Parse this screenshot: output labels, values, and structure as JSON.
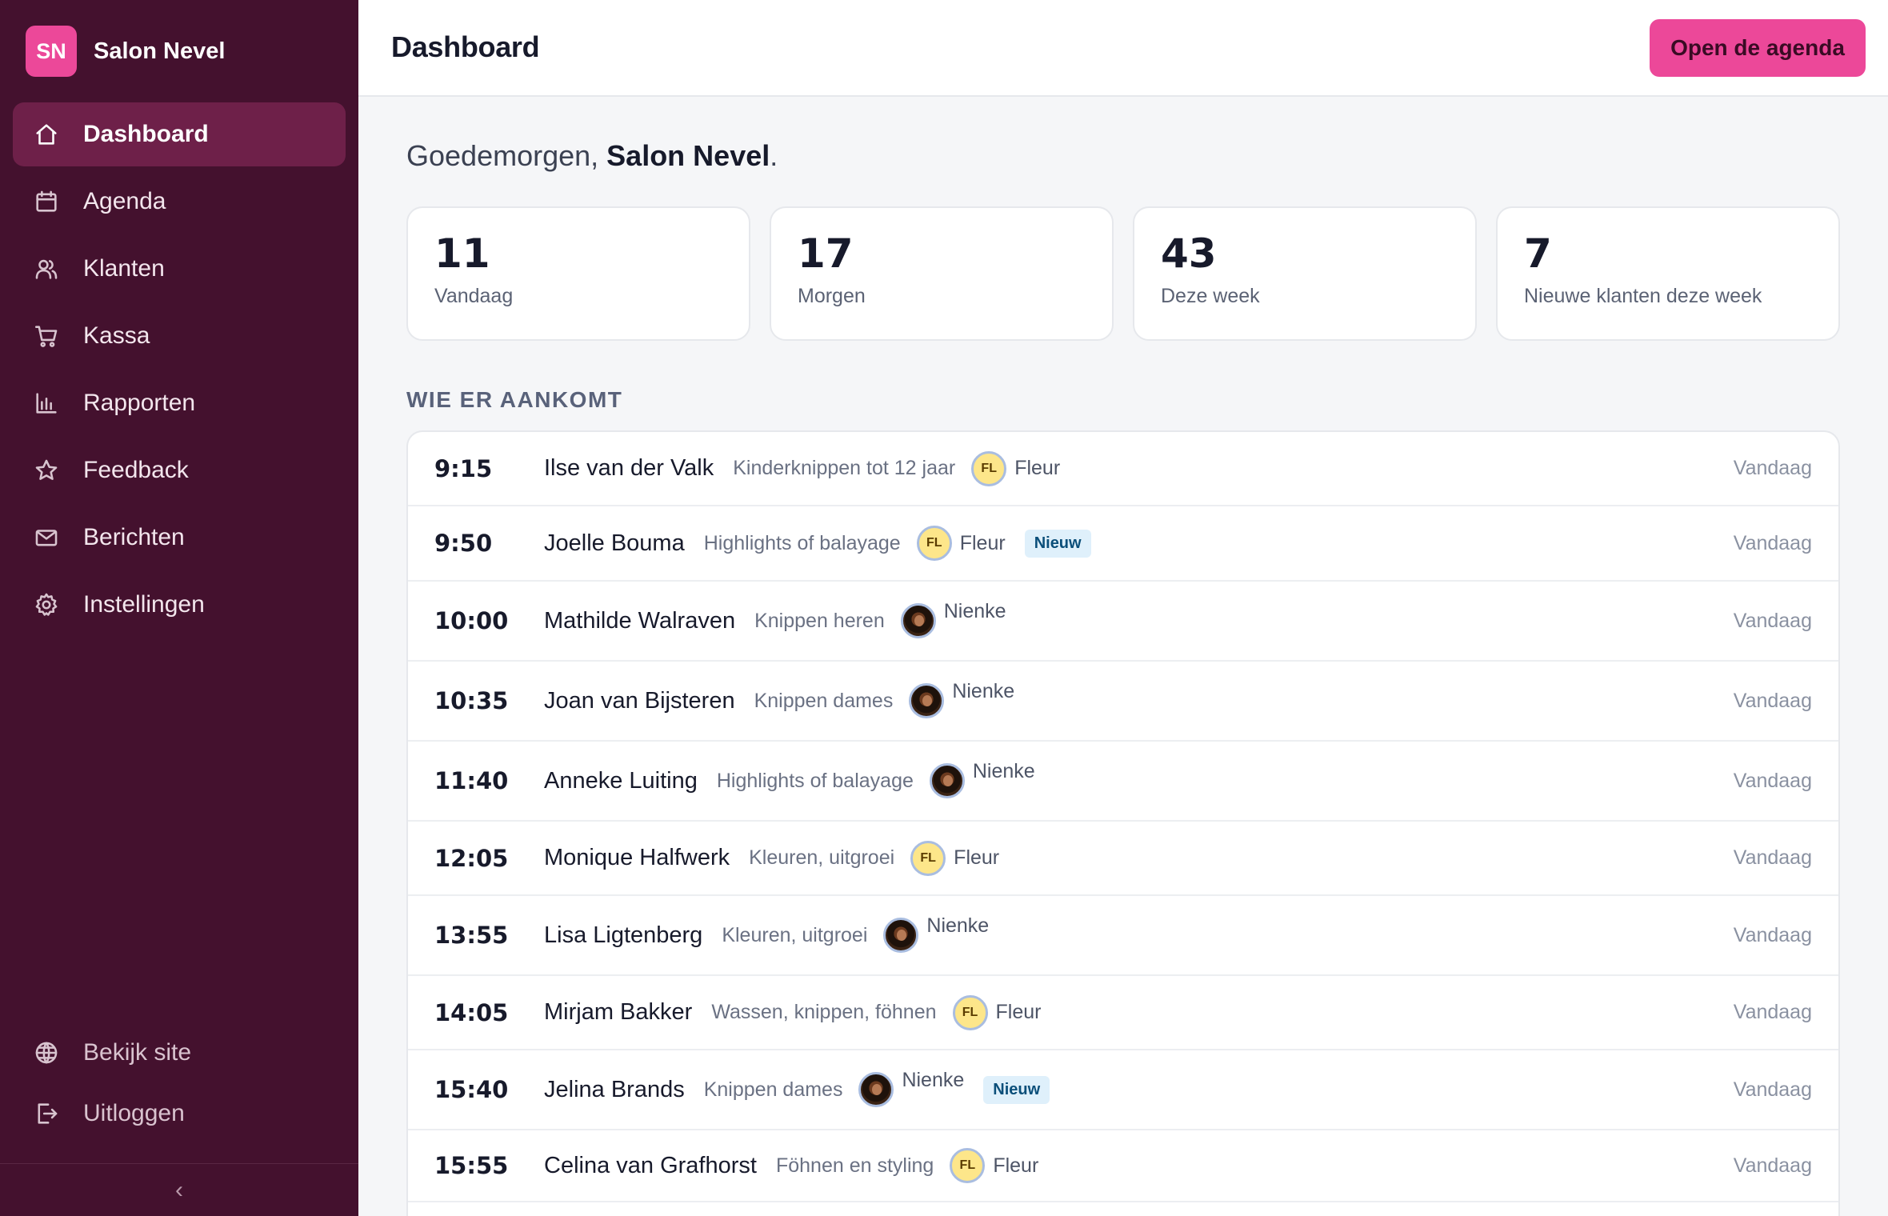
{
  "brand": {
    "logo_text": "SN",
    "name": "Salon Nevel"
  },
  "nav": [
    {
      "label": "Dashboard",
      "icon": "home-icon",
      "active": true
    },
    {
      "label": "Agenda",
      "icon": "calendar-icon"
    },
    {
      "label": "Klanten",
      "icon": "users-icon"
    },
    {
      "label": "Kassa",
      "icon": "cart-icon"
    },
    {
      "label": "Rapporten",
      "icon": "bar-chart-icon"
    },
    {
      "label": "Feedback",
      "icon": "star-icon"
    },
    {
      "label": "Berichten",
      "icon": "mail-icon"
    },
    {
      "label": "Instellingen",
      "icon": "gear-icon"
    }
  ],
  "nav_bottom": [
    {
      "label": "Bekijk site",
      "icon": "globe-icon"
    },
    {
      "label": "Uitloggen",
      "icon": "logout-icon"
    }
  ],
  "collapse_glyph": "‹",
  "header": {
    "title": "Dashboard",
    "primary_button": "Open de agenda"
  },
  "greeting": {
    "prefix": "Goedemorgen, ",
    "name": "Salon Nevel",
    "suffix": "."
  },
  "stats": [
    {
      "value": "11",
      "label": "Vandaag"
    },
    {
      "value": "17",
      "label": "Morgen"
    },
    {
      "value": "43",
      "label": "Deze week"
    },
    {
      "value": "7",
      "label": "Nieuwe klanten deze week"
    }
  ],
  "section_title": "WIE ER AANKOMT",
  "appointments": [
    {
      "time": "9:15",
      "name": "Ilse van der Valk",
      "service": "Kinderknippen tot 12 jaar",
      "staff": "Fleur",
      "staff_initials": "FL",
      "avatar": "initials",
      "badge": "",
      "day": "Vandaag"
    },
    {
      "time": "9:50",
      "name": "Joelle Bouma",
      "service": "Highlights of balayage",
      "staff": "Fleur",
      "staff_initials": "FL",
      "avatar": "initials",
      "badge": "Nieuw",
      "day": "Vandaag"
    },
    {
      "time": "10:00",
      "name": "Mathilde Walraven",
      "service": "Knippen heren",
      "staff": "Nienke",
      "staff_initials": "",
      "avatar": "photo",
      "badge": "",
      "day": "Vandaag"
    },
    {
      "time": "10:35",
      "name": "Joan van Bijsteren",
      "service": "Knippen dames",
      "staff": "Nienke",
      "staff_initials": "",
      "avatar": "photo",
      "badge": "",
      "day": "Vandaag"
    },
    {
      "time": "11:40",
      "name": "Anneke Luiting",
      "service": "Highlights of balayage",
      "staff": "Nienke",
      "staff_initials": "",
      "avatar": "photo",
      "badge": "",
      "day": "Vandaag"
    },
    {
      "time": "12:05",
      "name": "Monique Halfwerk",
      "service": "Kleuren, uitgroei",
      "staff": "Fleur",
      "staff_initials": "FL",
      "avatar": "initials",
      "badge": "",
      "day": "Vandaag"
    },
    {
      "time": "13:55",
      "name": "Lisa Ligtenberg",
      "service": "Kleuren, uitgroei",
      "staff": "Nienke",
      "staff_initials": "",
      "avatar": "photo",
      "badge": "",
      "day": "Vandaag"
    },
    {
      "time": "14:05",
      "name": "Mirjam Bakker",
      "service": "Wassen, knippen, föhnen",
      "staff": "Fleur",
      "staff_initials": "FL",
      "avatar": "initials",
      "badge": "",
      "day": "Vandaag"
    },
    {
      "time": "15:40",
      "name": "Jelina Brands",
      "service": "Knippen dames",
      "staff": "Nienke",
      "staff_initials": "",
      "avatar": "photo",
      "badge": "Nieuw",
      "day": "Vandaag"
    },
    {
      "time": "15:55",
      "name": "Celina van Grafhorst",
      "service": "Föhnen en styling",
      "staff": "Fleur",
      "staff_initials": "FL",
      "avatar": "initials",
      "badge": "",
      "day": "Vandaag"
    }
  ]
}
